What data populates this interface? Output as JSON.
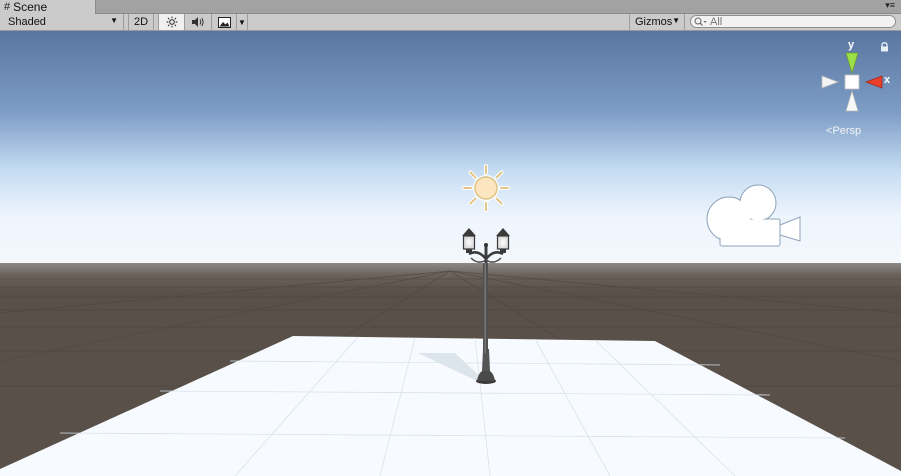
{
  "tab": {
    "label": "Scene"
  },
  "toolbar": {
    "shading_mode": "Shaded",
    "mode_2d_label": "2D",
    "lighting_icon": "sun-icon",
    "audio_icon": "speaker-icon",
    "effects_icon": "image-icon",
    "gizmos_label": "Gizmos",
    "search_placeholder": "All"
  },
  "viewport": {
    "projection_label": "Persp",
    "gizmo_axes": {
      "y": "y",
      "x": "x"
    },
    "objects": [
      "directional-light-icon",
      "street-lamp",
      "camera-icon",
      "ground-plane"
    ],
    "colors": {
      "sky_top": "#5876a0",
      "horizon": "#f0f6ff",
      "ground": "#585049",
      "plane": "#f7fbff"
    }
  }
}
